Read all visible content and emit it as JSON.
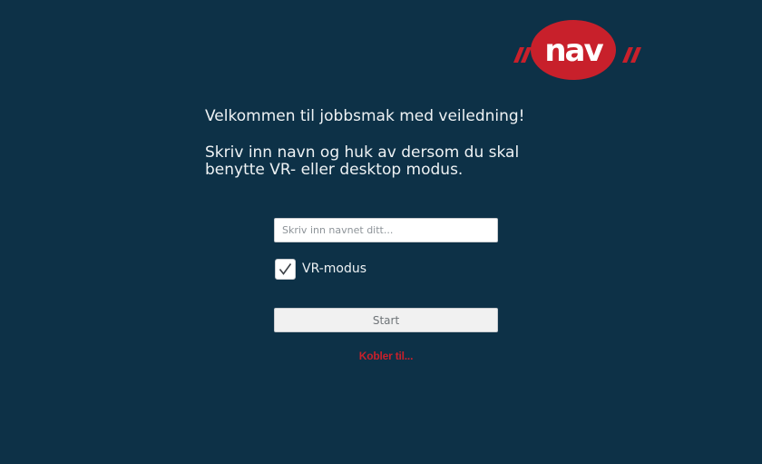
{
  "brand": {
    "logo_text": "nav",
    "logo_color": "#c8202b"
  },
  "intro": {
    "welcome": "Velkommen til jobbsmak med veiledning!",
    "instructions": "Skriv inn navn og huk av dersom du skal\nbenytte VR- eller desktop modus."
  },
  "form": {
    "name_placeholder": "Skriv inn navnet ditt...",
    "name_value": "",
    "vr_mode_label": "VR-modus",
    "vr_mode_checked": true,
    "start_label": "Start"
  },
  "status": {
    "text": "Kobler til...",
    "color": "#c8202b"
  },
  "colors": {
    "background": "#0d3147",
    "text": "#eef2f4"
  }
}
